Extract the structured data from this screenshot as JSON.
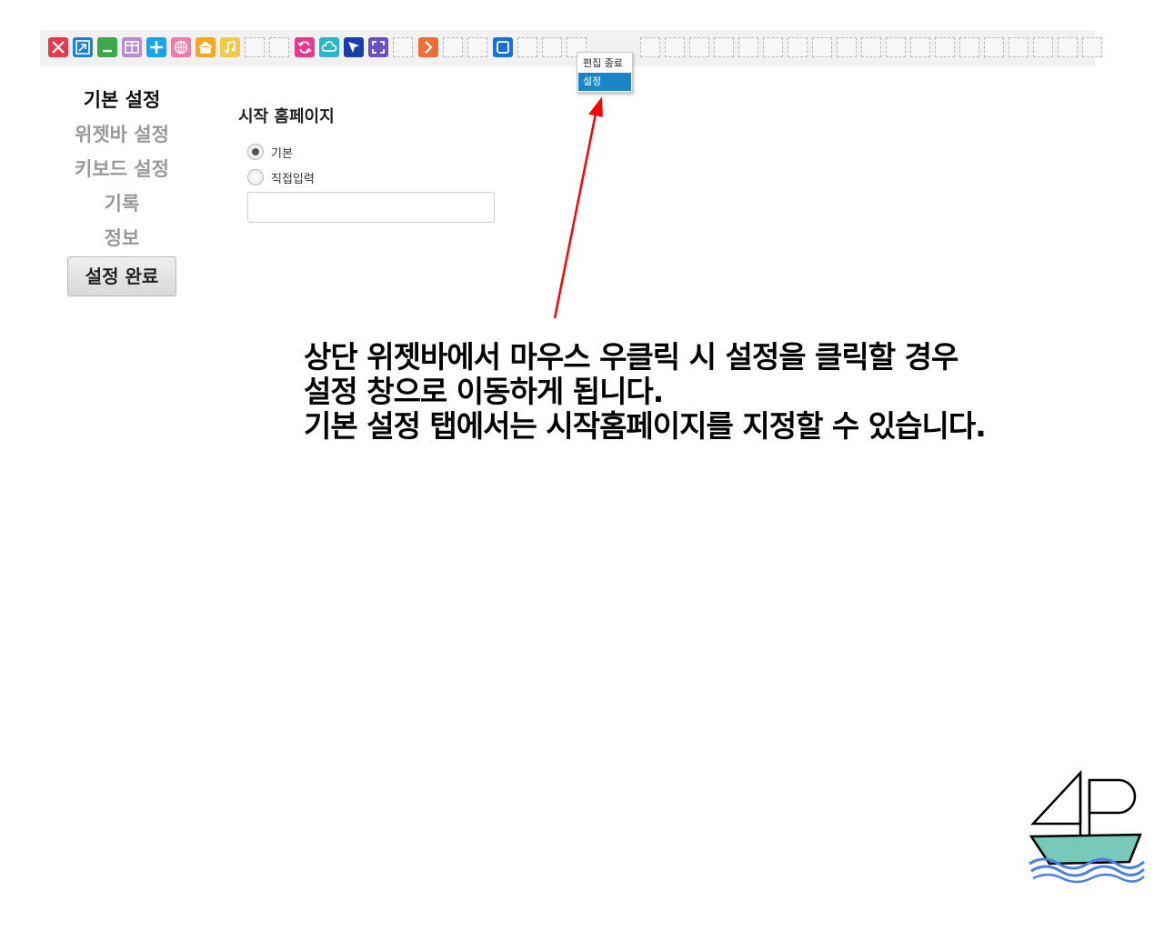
{
  "widget_bar": {
    "icons": [
      {
        "name": "close-icon",
        "color": "#e53c4b"
      },
      {
        "name": "restore-icon",
        "color": "#1d7fd6"
      },
      {
        "name": "minimize-icon",
        "color": "#3ca84a"
      },
      {
        "name": "split-view-icon",
        "color": "#b98ad6"
      },
      {
        "name": "add-icon",
        "color": "#1aa4e8"
      },
      {
        "name": "globe-icon",
        "color": "#f07aa8"
      },
      {
        "name": "home-icon",
        "color": "#f5a623"
      },
      {
        "name": "music-icon",
        "color": "#f2c94c"
      },
      {
        "name": "refresh-icon",
        "color": "#e8388b"
      },
      {
        "name": "weather-icon",
        "color": "#2bb7c8"
      },
      {
        "name": "pin-icon",
        "color": "#1a3fa8"
      },
      {
        "name": "fullscreen-icon",
        "color": "#6b4fc4"
      },
      {
        "name": "forward-icon",
        "color": "#f06d3a"
      },
      {
        "name": "window-icon",
        "color": "#1a6fd6"
      }
    ]
  },
  "context_menu": {
    "items": [
      "편집 종료",
      "설정"
    ]
  },
  "nav": {
    "items": [
      "기본 설정",
      "위젯바 설정",
      "키보드 설정",
      "기록",
      "정보"
    ],
    "done_button": "설정 완료"
  },
  "homepage": {
    "title": "시작  홈페이지",
    "options": [
      "기본",
      "직접입력"
    ],
    "selected": "기본",
    "url_value": ""
  },
  "annotation": {
    "lines": [
      "상단 위젯바에서 마우스 우클릭 시 설정을 클릭할 경우",
      "설정 창으로 이동하게 됩니다.",
      "기본 설정 탭에서는 시작홈페이지를 지정할 수 있습니다."
    ],
    "arrow_color": "#ff0000"
  }
}
